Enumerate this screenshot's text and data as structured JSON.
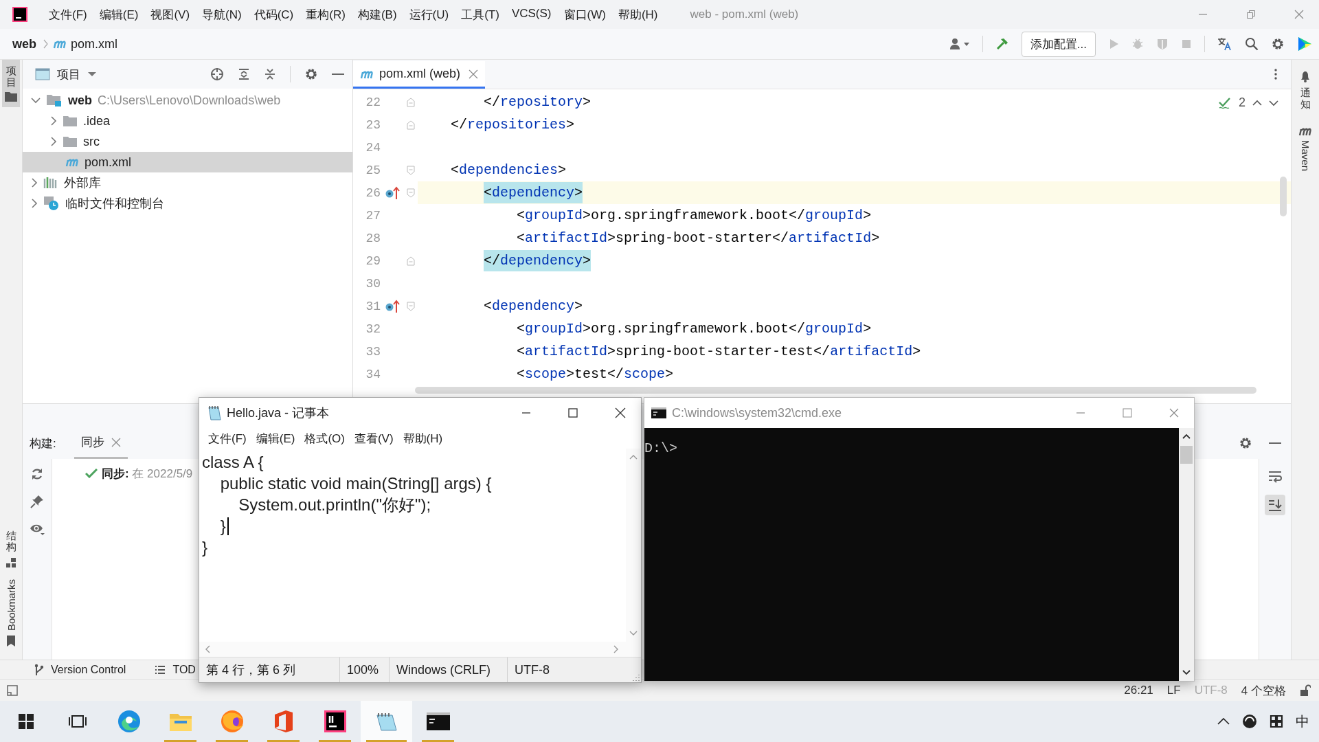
{
  "window": {
    "title": "web - pom.xml (web)"
  },
  "menu": [
    "文件(F)",
    "编辑(E)",
    "视图(V)",
    "导航(N)",
    "代码(C)",
    "重构(R)",
    "构建(B)",
    "运行(U)",
    "工具(T)",
    "VCS(S)",
    "窗口(W)",
    "帮助(H)"
  ],
  "breadcrumb": [
    "web",
    "pom.xml"
  ],
  "toolbar": {
    "run_config": "添加配置...",
    "actions": [
      {
        "kind": "run",
        "disabled": true
      },
      {
        "kind": "debug",
        "disabled": true
      },
      {
        "kind": "coverage",
        "disabled": true
      },
      {
        "kind": "stop",
        "disabled": true
      }
    ]
  },
  "left_strip": [
    {
      "kind": "project",
      "label": "项目",
      "selected": true
    },
    {
      "kind": "structure",
      "label": "结构",
      "selected": false
    },
    {
      "kind": "bookmarks",
      "label": "Bookmarks",
      "selected": false
    }
  ],
  "right_strip": [
    {
      "kind": "notifications",
      "label": "通知"
    },
    {
      "kind": "maven",
      "label": "Maven"
    }
  ],
  "project_panel": {
    "title": "项目",
    "tree": [
      {
        "kind": "module",
        "name": "web",
        "path": "C:\\Users\\Lenovo\\Downloads\\web",
        "expanded": true,
        "selected": false,
        "children": [
          {
            "kind": "folder",
            "name": ".idea",
            "expanded": false,
            "selected": false
          },
          {
            "kind": "folder",
            "name": "src",
            "expanded": false,
            "selected": false
          },
          {
            "kind": "maven",
            "name": "pom.xml",
            "selected": true
          }
        ]
      },
      {
        "kind": "library",
        "name": "外部库",
        "expanded": false,
        "selected": false
      },
      {
        "kind": "scratch",
        "name": "临时文件和控制台",
        "expanded": false,
        "selected": false
      }
    ]
  },
  "editor": {
    "tabs": [
      {
        "label": "pom.xml (web)",
        "selected": true
      }
    ],
    "inspection_count": "2",
    "lines": [
      {
        "number": "22",
        "text": "        </repository>",
        "fold_start": false,
        "fold_end": true,
        "marker": false,
        "current": false,
        "matched": false
      },
      {
        "number": "23",
        "text": "    </repositories>",
        "fold_start": false,
        "fold_end": true,
        "marker": false,
        "current": false,
        "matched": false
      },
      {
        "number": "24",
        "fold_start": false,
        "fold_end": false,
        "marker": false,
        "current": false,
        "matched": false
      },
      {
        "number": "25",
        "text": "    <dependencies>",
        "fold_start": true,
        "fold_end": false,
        "marker": false,
        "current": false,
        "matched": false
      },
      {
        "number": "26",
        "text": "        <dependency>",
        "fold_start": true,
        "fold_end": false,
        "marker": true,
        "current": true,
        "matched": true
      },
      {
        "number": "27",
        "text": "            <groupId>org.springframework.boot</groupId>",
        "fold_start": false,
        "fold_end": false,
        "marker": false,
        "current": false,
        "matched": false
      },
      {
        "number": "28",
        "text": "            <artifactId>spring-boot-starter</artifactId>",
        "fold_start": false,
        "fold_end": false,
        "marker": false,
        "current": false,
        "matched": false
      },
      {
        "number": "29",
        "text": "        </dependency>",
        "fold_start": false,
        "fold_end": true,
        "marker": false,
        "current": false,
        "matched": true
      },
      {
        "number": "30",
        "fold_start": false,
        "fold_end": false,
        "marker": false,
        "current": false,
        "matched": false
      },
      {
        "number": "31",
        "text": "        <dependency>",
        "fold_start": true,
        "fold_end": false,
        "marker": true,
        "current": false,
        "matched": false
      },
      {
        "number": "32",
        "text": "            <groupId>org.springframework.boot</groupId>",
        "fold_start": false,
        "fold_end": false,
        "marker": false,
        "current": false,
        "matched": false
      },
      {
        "number": "33",
        "text": "            <artifactId>spring-boot-starter-test</artifactId>",
        "fold_start": false,
        "fold_end": false,
        "marker": false,
        "current": false,
        "matched": false
      },
      {
        "number": "34",
        "text": "            <scope>test</scope>",
        "fold_start": false,
        "fold_end": false,
        "marker": false,
        "current": false,
        "matched": false
      }
    ]
  },
  "build_panel": {
    "label": "构建:",
    "tabs": [
      {
        "label": "同步",
        "selected": true
      }
    ],
    "items": [
      {
        "succeeded": true,
        "text": "**同步:** 在 2022/5/9"
      }
    ],
    "side_actions": [
      {
        "kind": "wrap",
        "selected": false
      },
      {
        "kind": "scroll_end",
        "selected": true
      }
    ]
  },
  "tool_window_bar": [
    {
      "kind": "vcs",
      "label": "Version Control"
    },
    {
      "kind": "todo",
      "label": "TOD"
    }
  ],
  "status_bar": [
    {
      "text": "26:21",
      "dimmed": false
    },
    {
      "text": "LF",
      "dimmed": false
    },
    {
      "text": "UTF-8",
      "dimmed": true
    },
    {
      "text": "4 个空格",
      "dimmed": false
    }
  ],
  "notepad": {
    "title": "Hello.java - 记事本",
    "menu": [
      "文件(F)",
      "编辑(E)",
      "格式(O)",
      "查看(V)",
      "帮助(H)"
    ],
    "lines": [
      {
        "text": "class A {",
        "cursor": false
      },
      {
        "text": "    public static void main(String[] args) {",
        "cursor": false
      },
      {
        "text": "        System.out.println(\"你好\");",
        "cursor": false
      },
      {
        "text": "    }",
        "cursor": true
      },
      {
        "text": "}",
        "cursor": false
      }
    ],
    "status": [
      "第 4 行，第 6 列",
      "100%",
      "Windows (CRLF)",
      "UTF-8"
    ]
  },
  "console": {
    "title": "C:\\windows\\system32\\cmd.exe",
    "lines": [
      "D:\\>"
    ]
  },
  "taskbar": {
    "apps": [
      {
        "kind": "start",
        "running": false,
        "selected": false
      },
      {
        "kind": "task_view",
        "running": false,
        "selected": false
      },
      {
        "kind": "browser_blue",
        "running": false,
        "selected": false
      },
      {
        "kind": "folder",
        "running": true,
        "selected": false
      },
      {
        "kind": "browser_orange",
        "running": true,
        "selected": false
      },
      {
        "kind": "office",
        "running": true,
        "selected": false
      },
      {
        "kind": "ide",
        "running": true,
        "selected": false
      },
      {
        "kind": "notepad",
        "running": true,
        "selected": true
      },
      {
        "kind": "terminal",
        "running": true,
        "selected": false
      }
    ],
    "input_mode": "中"
  }
}
